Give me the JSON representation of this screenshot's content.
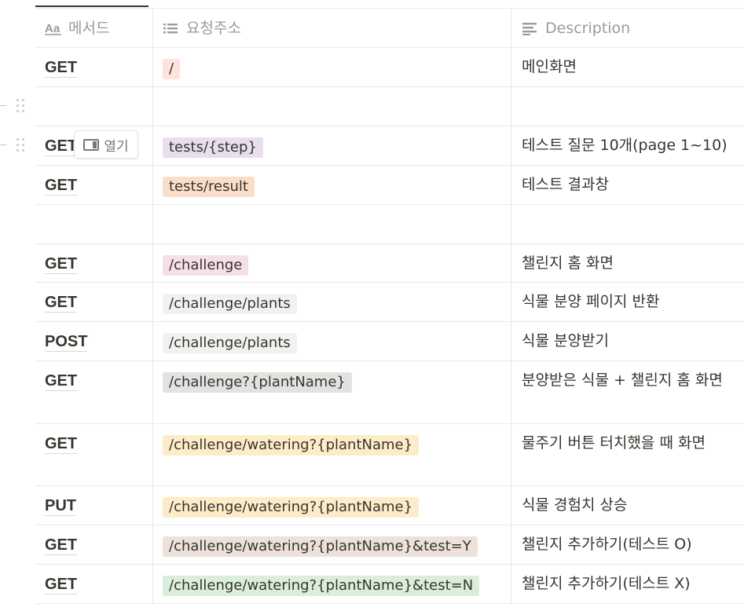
{
  "header": {
    "col1": "메서드",
    "col2": "요청주소",
    "col3": "Description"
  },
  "open_button": {
    "label": "열기"
  },
  "rows": [
    {
      "method": "GET",
      "url": "/",
      "tag": "red",
      "desc": "메인화면"
    },
    {
      "method": "",
      "url": "",
      "tag": "",
      "desc": ""
    },
    {
      "method": "GET",
      "url": "tests/{step}",
      "tag": "purple",
      "desc": "테스트 질문 10개(page 1~10)"
    },
    {
      "method": "GET",
      "url": "tests/result",
      "tag": "orange",
      "desc": "테스트 결과창"
    },
    {
      "method": "",
      "url": "",
      "tag": "",
      "desc": ""
    },
    {
      "method": "GET",
      "url": "/challenge",
      "tag": "pink",
      "desc": "챌린지 홈 화면"
    },
    {
      "method": "GET",
      "url": "/challenge/plants",
      "tag": "gray",
      "desc": "식물 분양 페이지 반환"
    },
    {
      "method": "POST",
      "url": "/challenge/plants",
      "tag": "gray",
      "desc": "식물 분양받기"
    },
    {
      "method": "GET",
      "url": "/challenge?{plantName}",
      "tag": "gray2",
      "desc": "분양받은 식물 + 챌린지 홈 화면"
    },
    {
      "method": "GET",
      "url": "/challenge/watering?{plantName}",
      "tag": "yellow",
      "desc": "물주기 버튼 터치했을 때 화면"
    },
    {
      "method": "PUT",
      "url": "/challenge/watering?{plantName}",
      "tag": "yellow",
      "desc": "식물 경험치 상승"
    },
    {
      "method": "GET",
      "url": "/challenge/watering?{plantName}&test=Y",
      "tag": "brown",
      "desc": "챌린지 추가하기(테스트 O)"
    },
    {
      "method": "GET",
      "url": "/challenge/watering?{plantName}&test=N",
      "tag": "green",
      "desc": "챌린지 추가하기(테스트 X)"
    }
  ],
  "icons": {
    "col1": "title-text-icon",
    "col2": "list-icon",
    "col3": "text-align-icon",
    "drag": "drag-handle-icon",
    "open": "open-panel-icon"
  },
  "colors": {
    "text": "#37352f",
    "muted": "#9b9a97",
    "border": "#e9e9e7",
    "red": "#ffe2dd",
    "purple": "#e8deee",
    "orange": "#fadec9",
    "pink": "#f5e0e9",
    "gray": "#f1f1ef",
    "gray2": "#e3e2e0",
    "yellow": "#fdecc8",
    "brown": "#eee0da",
    "green": "#dbeddb"
  }
}
